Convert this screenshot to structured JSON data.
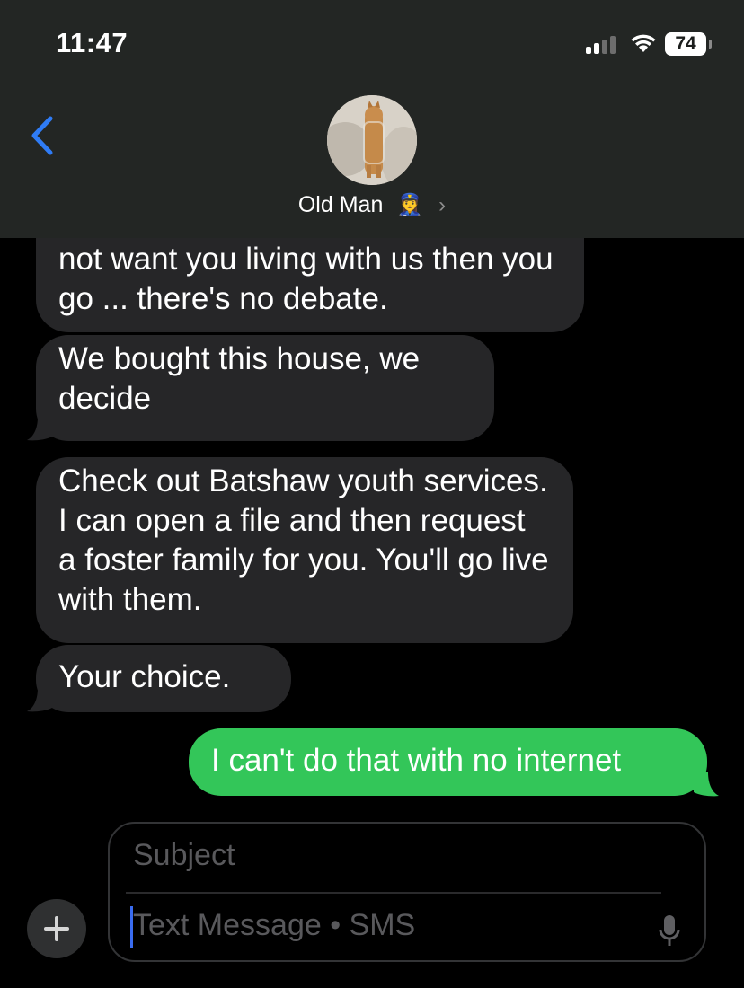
{
  "status_bar": {
    "time": "11:47",
    "battery": "74"
  },
  "header": {
    "contact_name": "Old Man",
    "contact_emoji": "👮‍♀️",
    "chevron": "›"
  },
  "messages": [
    {
      "direction": "incoming",
      "text": "not want you living with us then you go ... there's no debate."
    },
    {
      "direction": "incoming",
      "text": "We bought this house, we decide"
    },
    {
      "direction": "incoming",
      "text": "Check out Batshaw youth services.  I can open a file and then request a foster family for you.  You'll go live with them."
    },
    {
      "direction": "incoming",
      "text": "Your choice."
    },
    {
      "direction": "outgoing",
      "text": "I can't do that with no internet"
    }
  ],
  "composer": {
    "subject_placeholder": "Subject",
    "message_placeholder": "Text Message • SMS"
  },
  "colors": {
    "incoming_bubble": "#262628",
    "outgoing_bubble": "#33c659",
    "header_bg": "#232624",
    "accent": "#2f7cf6"
  },
  "icons": {
    "back": "chevron-left-icon",
    "add": "plus-icon",
    "mic": "microphone-icon",
    "wifi": "wifi-icon",
    "signal": "cellular-signal-icon"
  }
}
